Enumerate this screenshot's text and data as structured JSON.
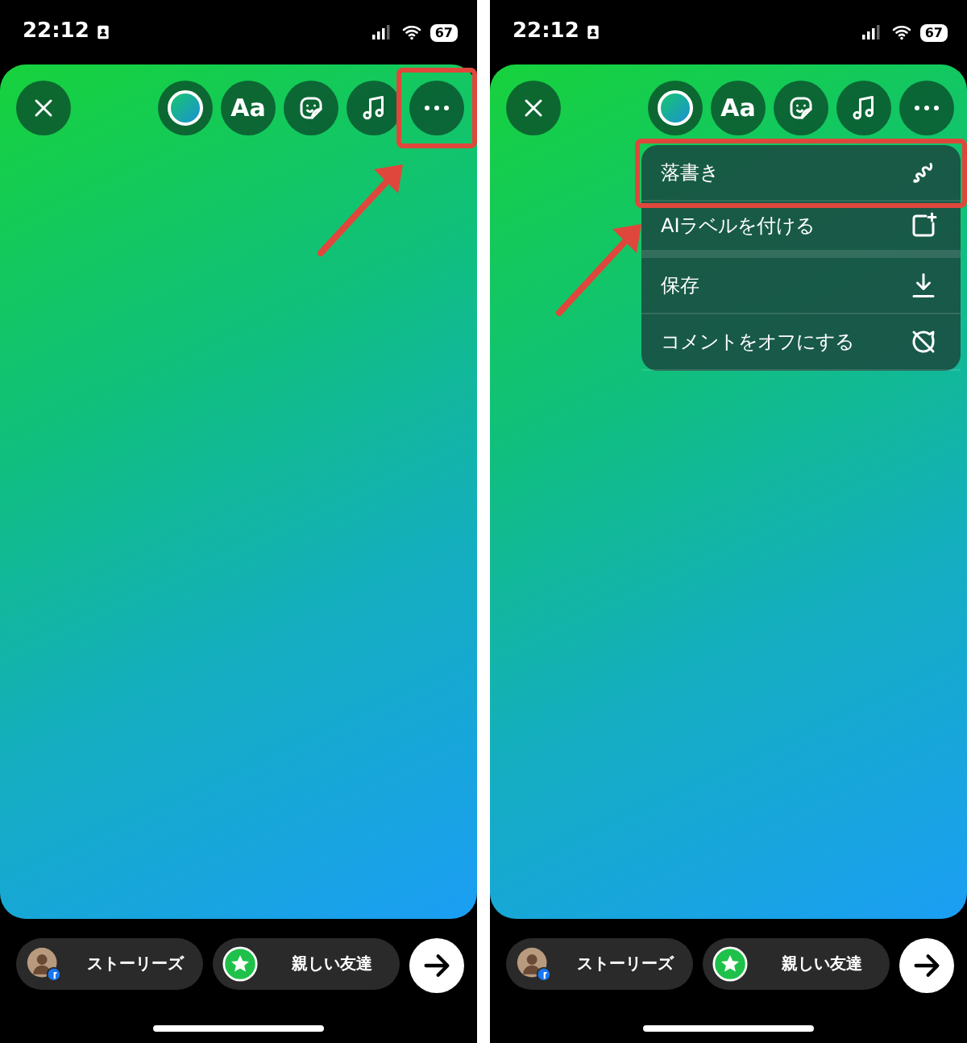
{
  "screens": [
    {
      "status_bar": {
        "time": "22:12",
        "battery": "67"
      },
      "toolbar": [
        {
          "kind": "close",
          "highlighted": false
        },
        {
          "kind": "color",
          "highlighted": false
        },
        {
          "kind": "text",
          "label": "Aa",
          "highlighted": false
        },
        {
          "kind": "sticker",
          "highlighted": false
        },
        {
          "kind": "music",
          "highlighted": false
        },
        {
          "kind": "more",
          "highlighted": true
        }
      ],
      "annotation_arrow": true,
      "share": [
        {
          "kind": "story",
          "label": "ストーリーズ"
        },
        {
          "kind": "close_friends",
          "label": "親しい友達"
        }
      ]
    },
    {
      "status_bar": {
        "time": "22:12",
        "battery": "67"
      },
      "toolbar": [
        {
          "kind": "close",
          "highlighted": false
        },
        {
          "kind": "color",
          "highlighted": false
        },
        {
          "kind": "text",
          "label": "Aa",
          "highlighted": false
        },
        {
          "kind": "sticker",
          "highlighted": false
        },
        {
          "kind": "music",
          "highlighted": false
        },
        {
          "kind": "more",
          "highlighted": false
        }
      ],
      "menu": [
        {
          "kind": "draw",
          "label": "落書き",
          "highlighted": true
        },
        {
          "kind": "ai_label",
          "label": "AIラベルを付ける",
          "highlighted": false
        },
        {
          "kind": "save",
          "label": "保存",
          "highlighted": false
        },
        {
          "kind": "comments_off",
          "label": "コメントをオフにする",
          "highlighted": false
        }
      ],
      "annotation_arrow": true,
      "share": [
        {
          "kind": "story",
          "label": "ストーリーズ"
        },
        {
          "kind": "close_friends",
          "label": "親しい友達"
        }
      ]
    }
  ]
}
